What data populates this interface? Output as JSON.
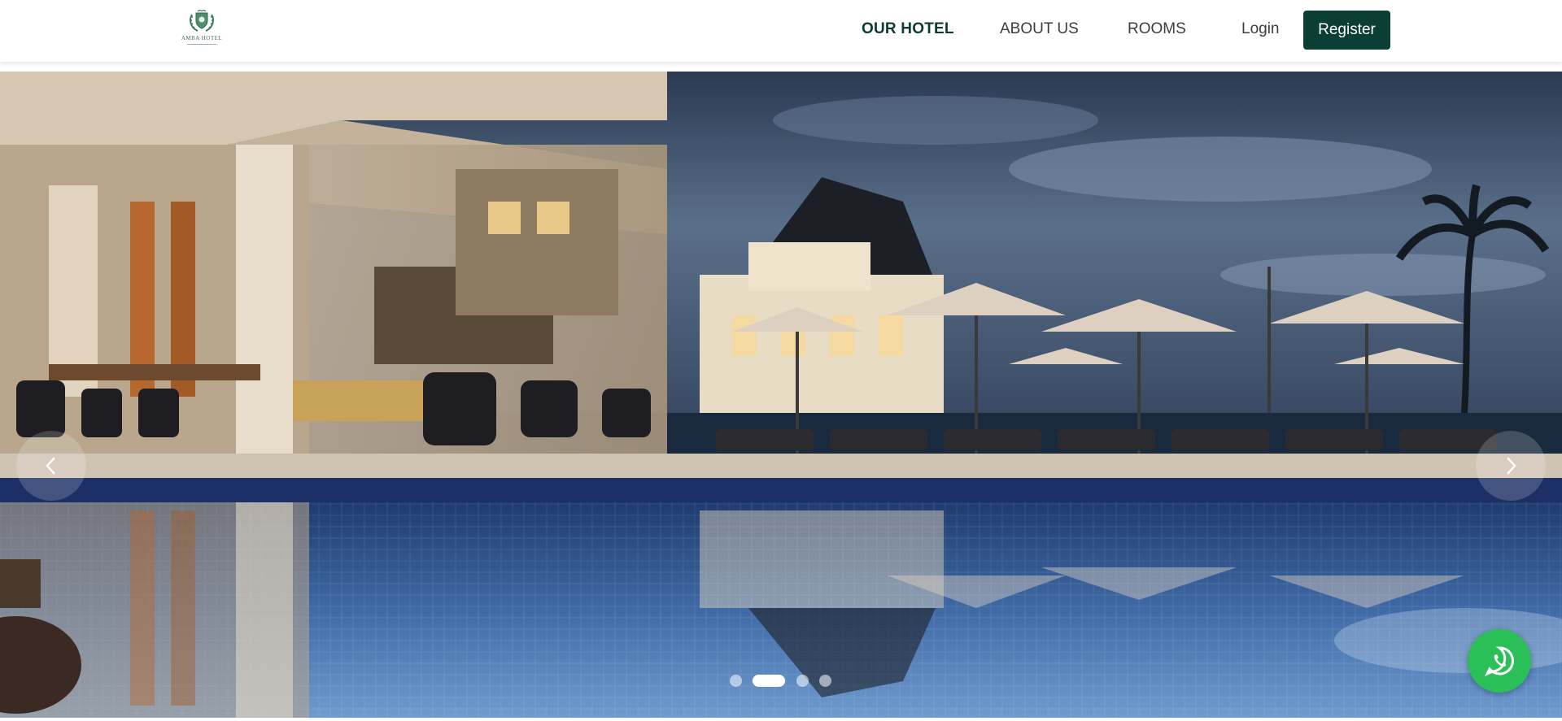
{
  "brand": {
    "name": "AMBA HOTEL",
    "logo_icon": "crest-logo-icon",
    "primary_color": "#0b3f35"
  },
  "nav": {
    "items": [
      {
        "label": "OUR HOTEL",
        "active": true
      },
      {
        "label": "ABOUT US",
        "active": false
      },
      {
        "label": "ROOMS",
        "active": false
      }
    ],
    "login_label": "Login",
    "register_label": "Register"
  },
  "carousel": {
    "slide_count": 4,
    "active_index": 1,
    "prev_icon": "chevron-left-icon",
    "next_icon": "chevron-right-icon",
    "slide_description": "hotel pool terrace at dusk"
  },
  "whatsapp": {
    "icon": "whatsapp-icon",
    "color": "#2bbf57"
  }
}
